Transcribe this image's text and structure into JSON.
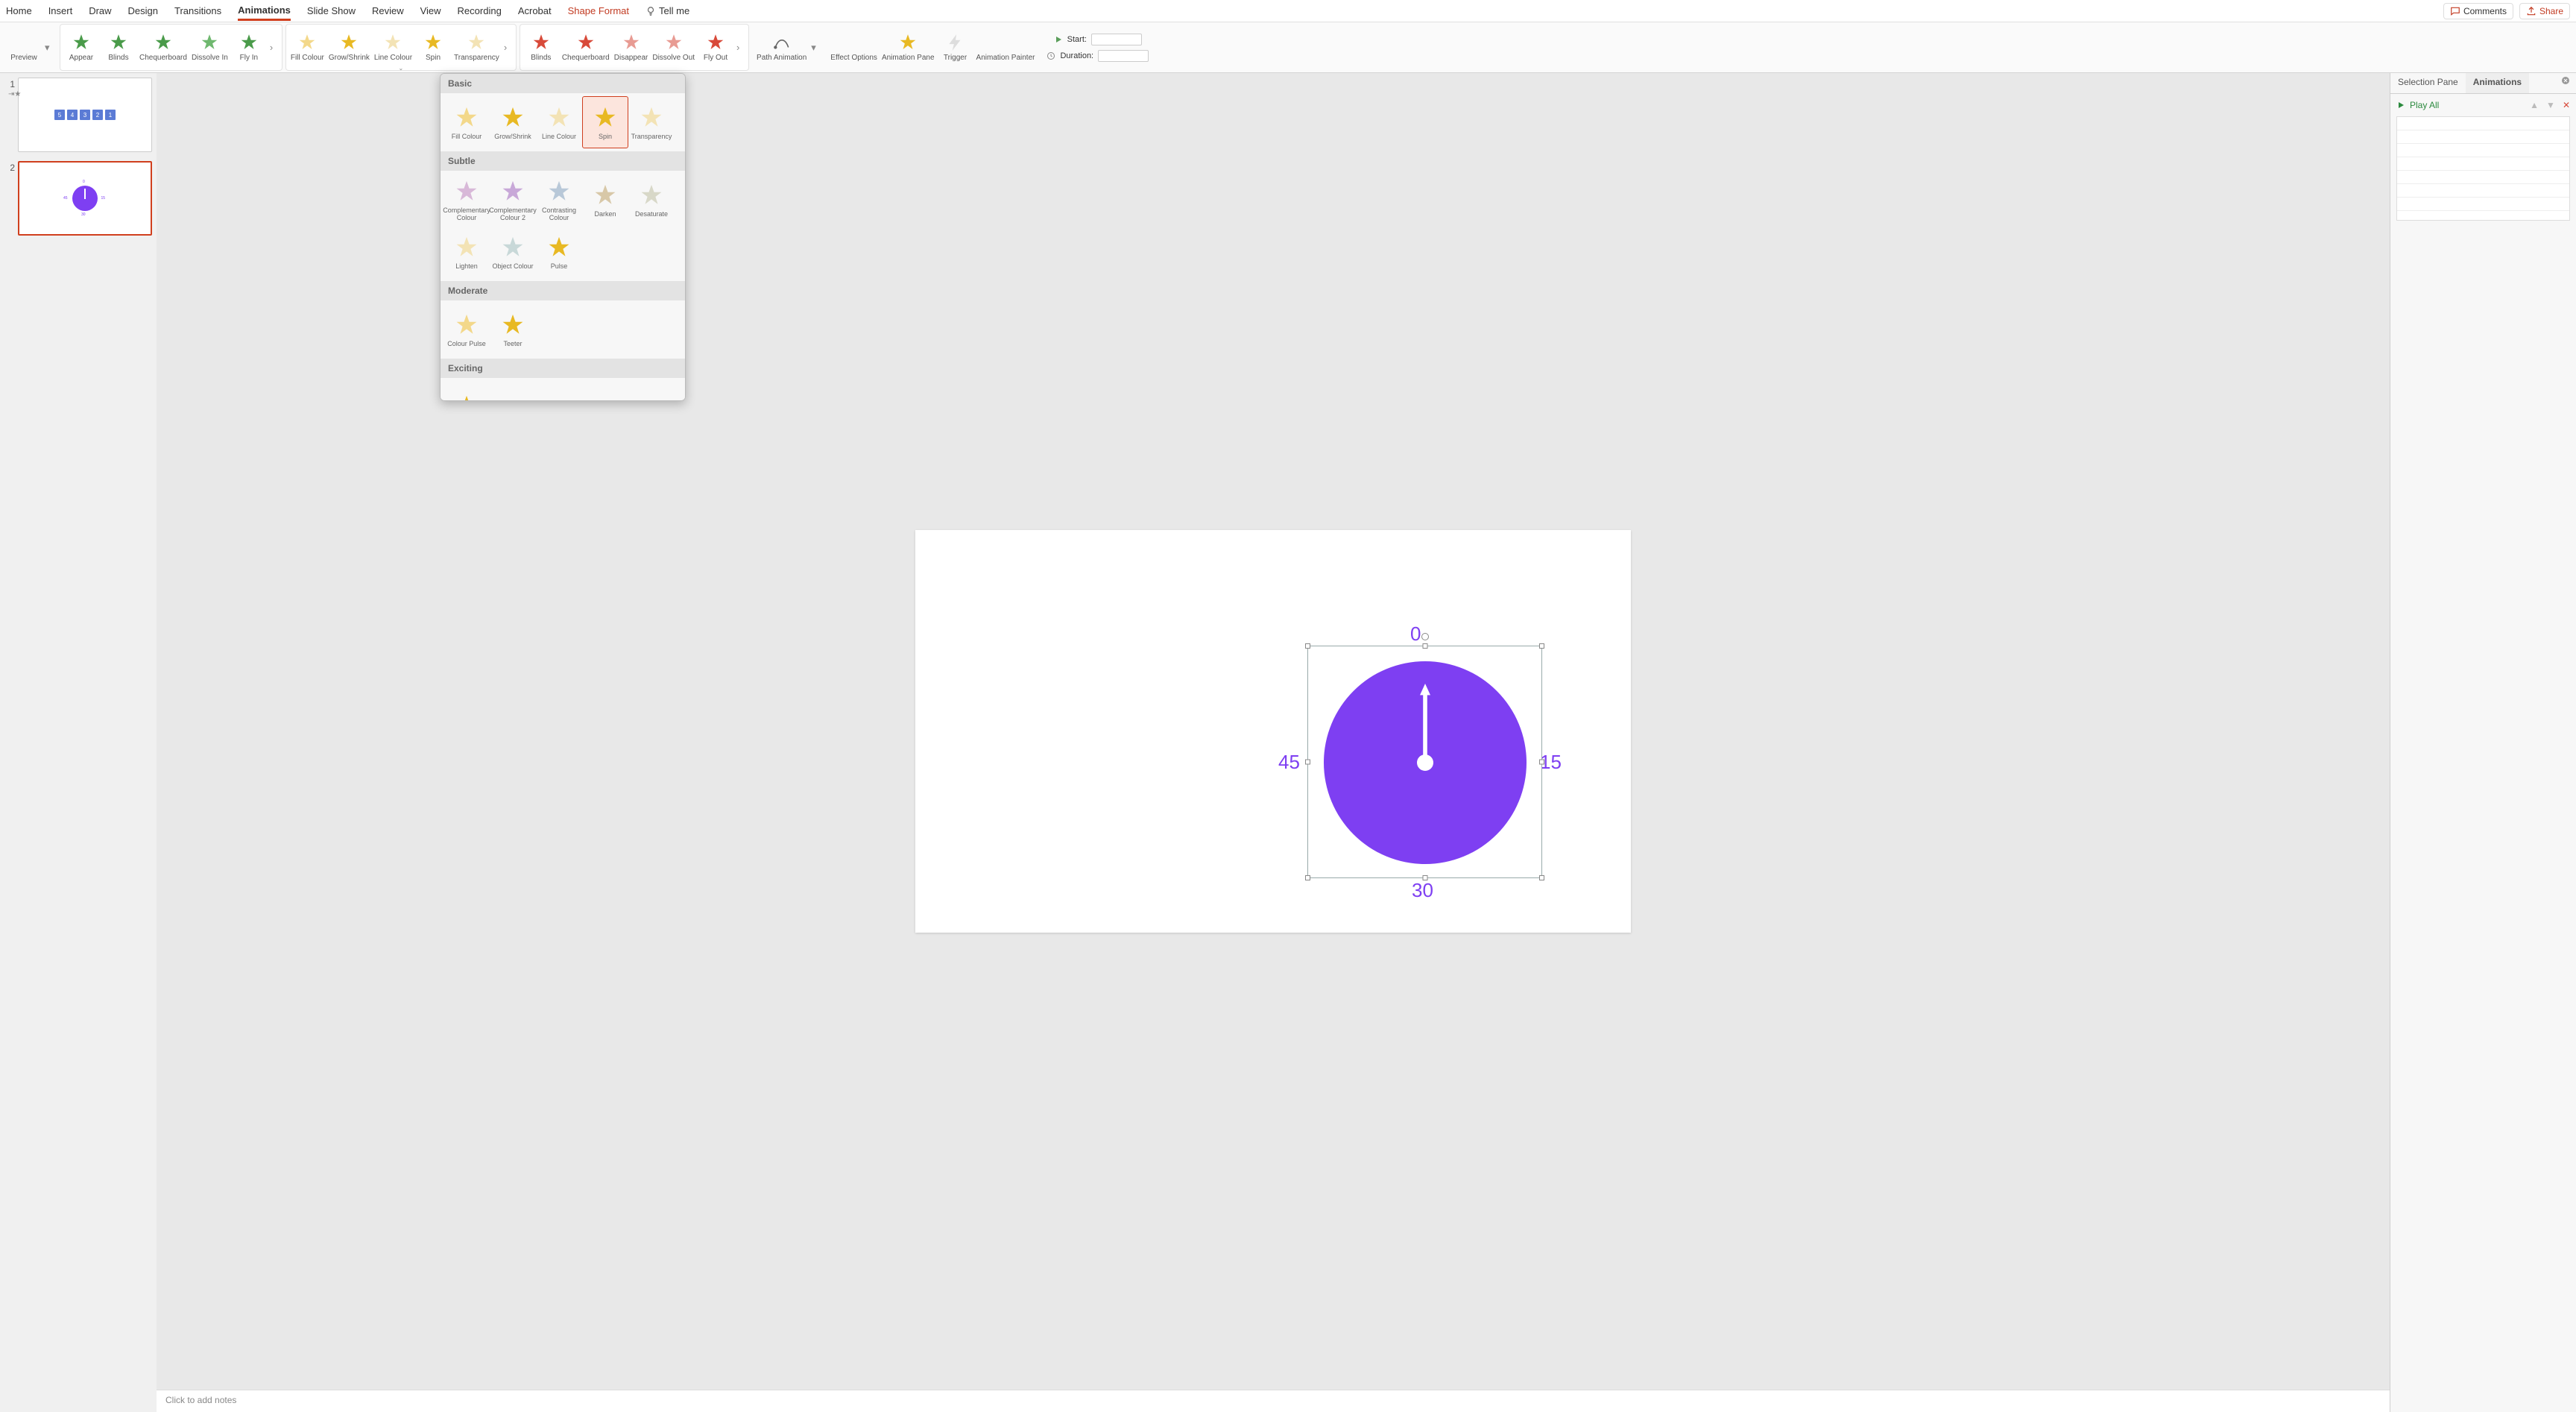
{
  "menu": [
    "Home",
    "Insert",
    "Draw",
    "Design",
    "Transitions",
    "Animations",
    "Slide Show",
    "Review",
    "View",
    "Recording",
    "Acrobat",
    "Shape Format"
  ],
  "active_menu": "Animations",
  "tell_me": "Tell me",
  "top": {
    "comments": "Comments",
    "share": "Share"
  },
  "ribbon": {
    "preview": "Preview",
    "entrance": [
      "Appear",
      "Blinds",
      "Chequerboard",
      "Dissolve In",
      "Fly In"
    ],
    "emphasis": [
      "Fill Colour",
      "Grow/Shrink",
      "Line Colour",
      "Spin",
      "Transparency"
    ],
    "exit": [
      "Blinds",
      "Chequerboard",
      "Disappear",
      "Dissolve Out",
      "Fly Out"
    ],
    "path": "Path Animation",
    "effect_options": "Effect Options",
    "anim_pane": "Animation Pane",
    "trigger": "Trigger",
    "painter": "Animation Painter",
    "start": "Start:",
    "duration": "Duration:",
    "start_val": "",
    "duration_val": ""
  },
  "emph_panel": {
    "cats": [
      {
        "name": "Basic",
        "items": [
          "Fill Colour",
          "Grow/Shrink",
          "Line Colour",
          "Spin",
          "Transparency"
        ],
        "selected": "Spin"
      },
      {
        "name": "Subtle",
        "items": [
          "Complementary Colour",
          "Complementary Colour 2",
          "Contrasting Colour",
          "Darken",
          "Desaturate",
          "Lighten",
          "Object Colour",
          "Pulse"
        ]
      },
      {
        "name": "Moderate",
        "items": [
          "Colour Pulse",
          "Teeter"
        ]
      },
      {
        "name": "Exciting",
        "items": [
          ""
        ]
      }
    ]
  },
  "thumbs": {
    "slide1_boxes": [
      "5",
      "4",
      "3",
      "2",
      "1"
    ],
    "slide2_labels": {
      "t": "0",
      "r": "15",
      "b": "30",
      "l": "45"
    }
  },
  "slide": {
    "lbl_top": "0",
    "lbl_right": "15",
    "lbl_bottom": "30",
    "lbl_left": "45"
  },
  "notes_placeholder": "Click to add notes",
  "panes": {
    "selection": "Selection Pane",
    "animations": "Animations",
    "play_all": "Play All"
  },
  "colors": {
    "accent": "#d03f1e",
    "purple": "#7e3ff2",
    "green_star": "#4a9b4a",
    "gold_star": "#e8b923",
    "red_star": "#d84a3a"
  }
}
